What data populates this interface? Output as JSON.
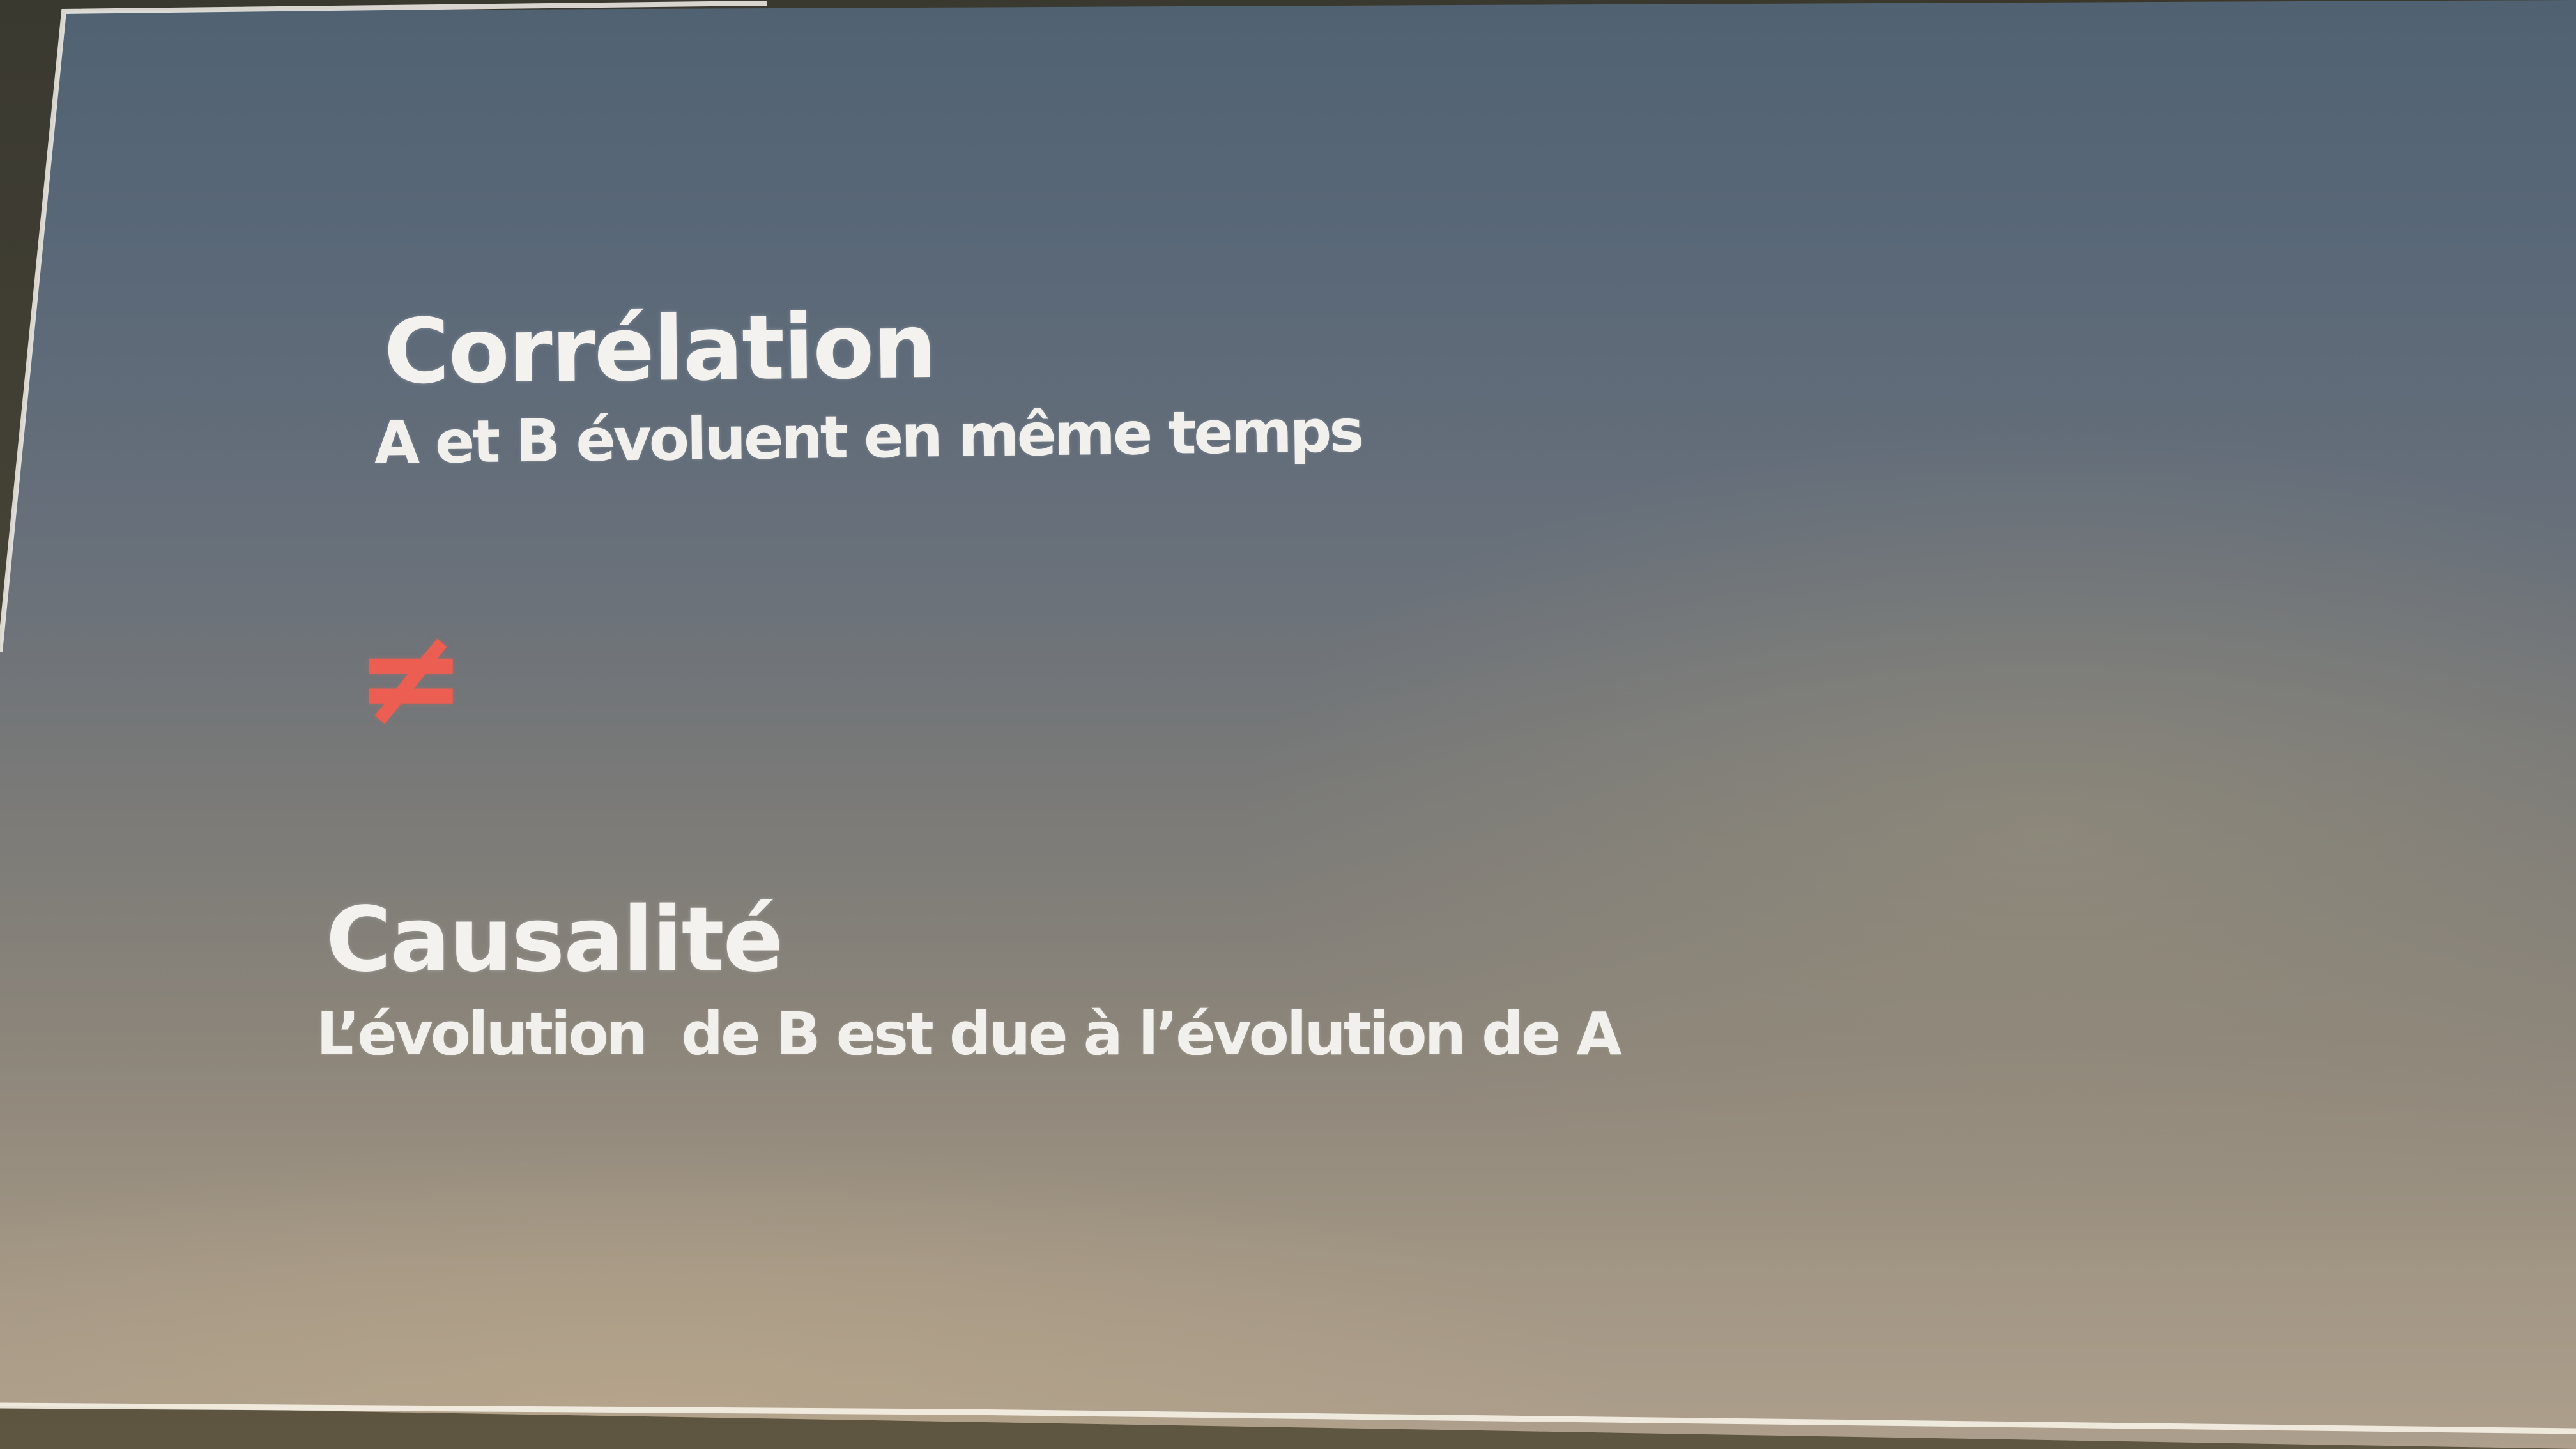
{
  "slide": {
    "correlation": {
      "title": "Corrélation",
      "description": "A et B évoluent en même temps"
    },
    "symbol": "≠",
    "causalite": {
      "title": "Causalité",
      "description": "L’évolution  de B est due à l’évolution de A"
    }
  },
  "colors": {
    "text": "#f4f2ee",
    "accent": "#ec5e52"
  }
}
